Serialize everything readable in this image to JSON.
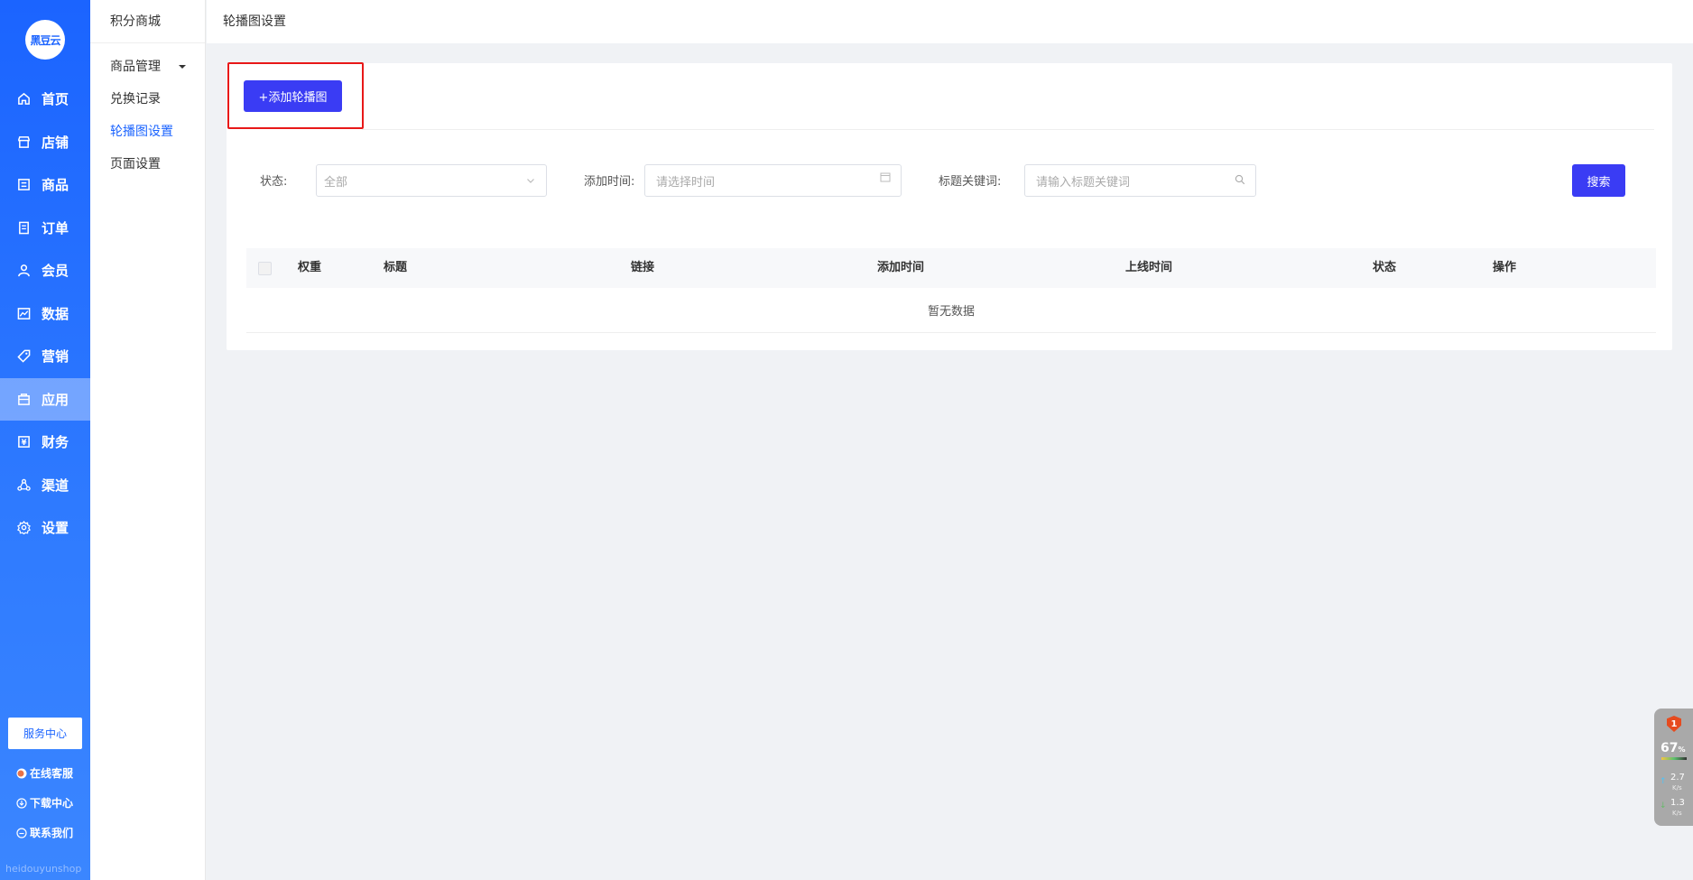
{
  "brand": {
    "logo_text": "黑豆云"
  },
  "sidebar": {
    "items": [
      {
        "label": "首页",
        "icon": "home-icon"
      },
      {
        "label": "店铺",
        "icon": "store-icon"
      },
      {
        "label": "商品",
        "icon": "product-icon"
      },
      {
        "label": "订单",
        "icon": "order-icon"
      },
      {
        "label": "会员",
        "icon": "member-icon"
      },
      {
        "label": "数据",
        "icon": "chart-icon"
      },
      {
        "label": "营销",
        "icon": "tag-icon"
      },
      {
        "label": "应用",
        "icon": "app-icon",
        "active": true
      },
      {
        "label": "财务",
        "icon": "finance-icon"
      },
      {
        "label": "渠道",
        "icon": "channel-icon"
      },
      {
        "label": "设置",
        "icon": "gear-icon"
      }
    ],
    "service_center": "服务中心",
    "online_service": "在线客服",
    "download_center": "下载中心",
    "contact_us": "联系我们",
    "footer": "heidouyunshop"
  },
  "subnav": {
    "title": "积分商城",
    "items": [
      {
        "label": "商品管理",
        "has_caret": true
      },
      {
        "label": "兑换记录"
      },
      {
        "label": "轮播图设置",
        "active": true
      },
      {
        "label": "页面设置"
      }
    ]
  },
  "header": {
    "title": "轮播图设置"
  },
  "toolbar": {
    "add_label": "+添加轮播图"
  },
  "filters": {
    "status_label": "状态:",
    "status_value": "全部",
    "time_label": "添加时间:",
    "time_placeholder": "请选择时间",
    "keyword_label": "标题关键词:",
    "keyword_placeholder": "请输入标题关键词",
    "search_label": "搜索"
  },
  "table": {
    "columns": [
      "权重",
      "标题",
      "链接",
      "添加时间",
      "上线时间",
      "状态",
      "操作"
    ],
    "empty_text": "暂无数据"
  },
  "widget": {
    "badge": "1",
    "percent": "67",
    "percent_unit": "%",
    "upload_speed": "2.7",
    "download_speed": "1.3",
    "speed_unit": "K/s"
  },
  "colors": {
    "primary": "#1b64ff",
    "button": "#3a3cf4",
    "highlight": "#e81818"
  }
}
